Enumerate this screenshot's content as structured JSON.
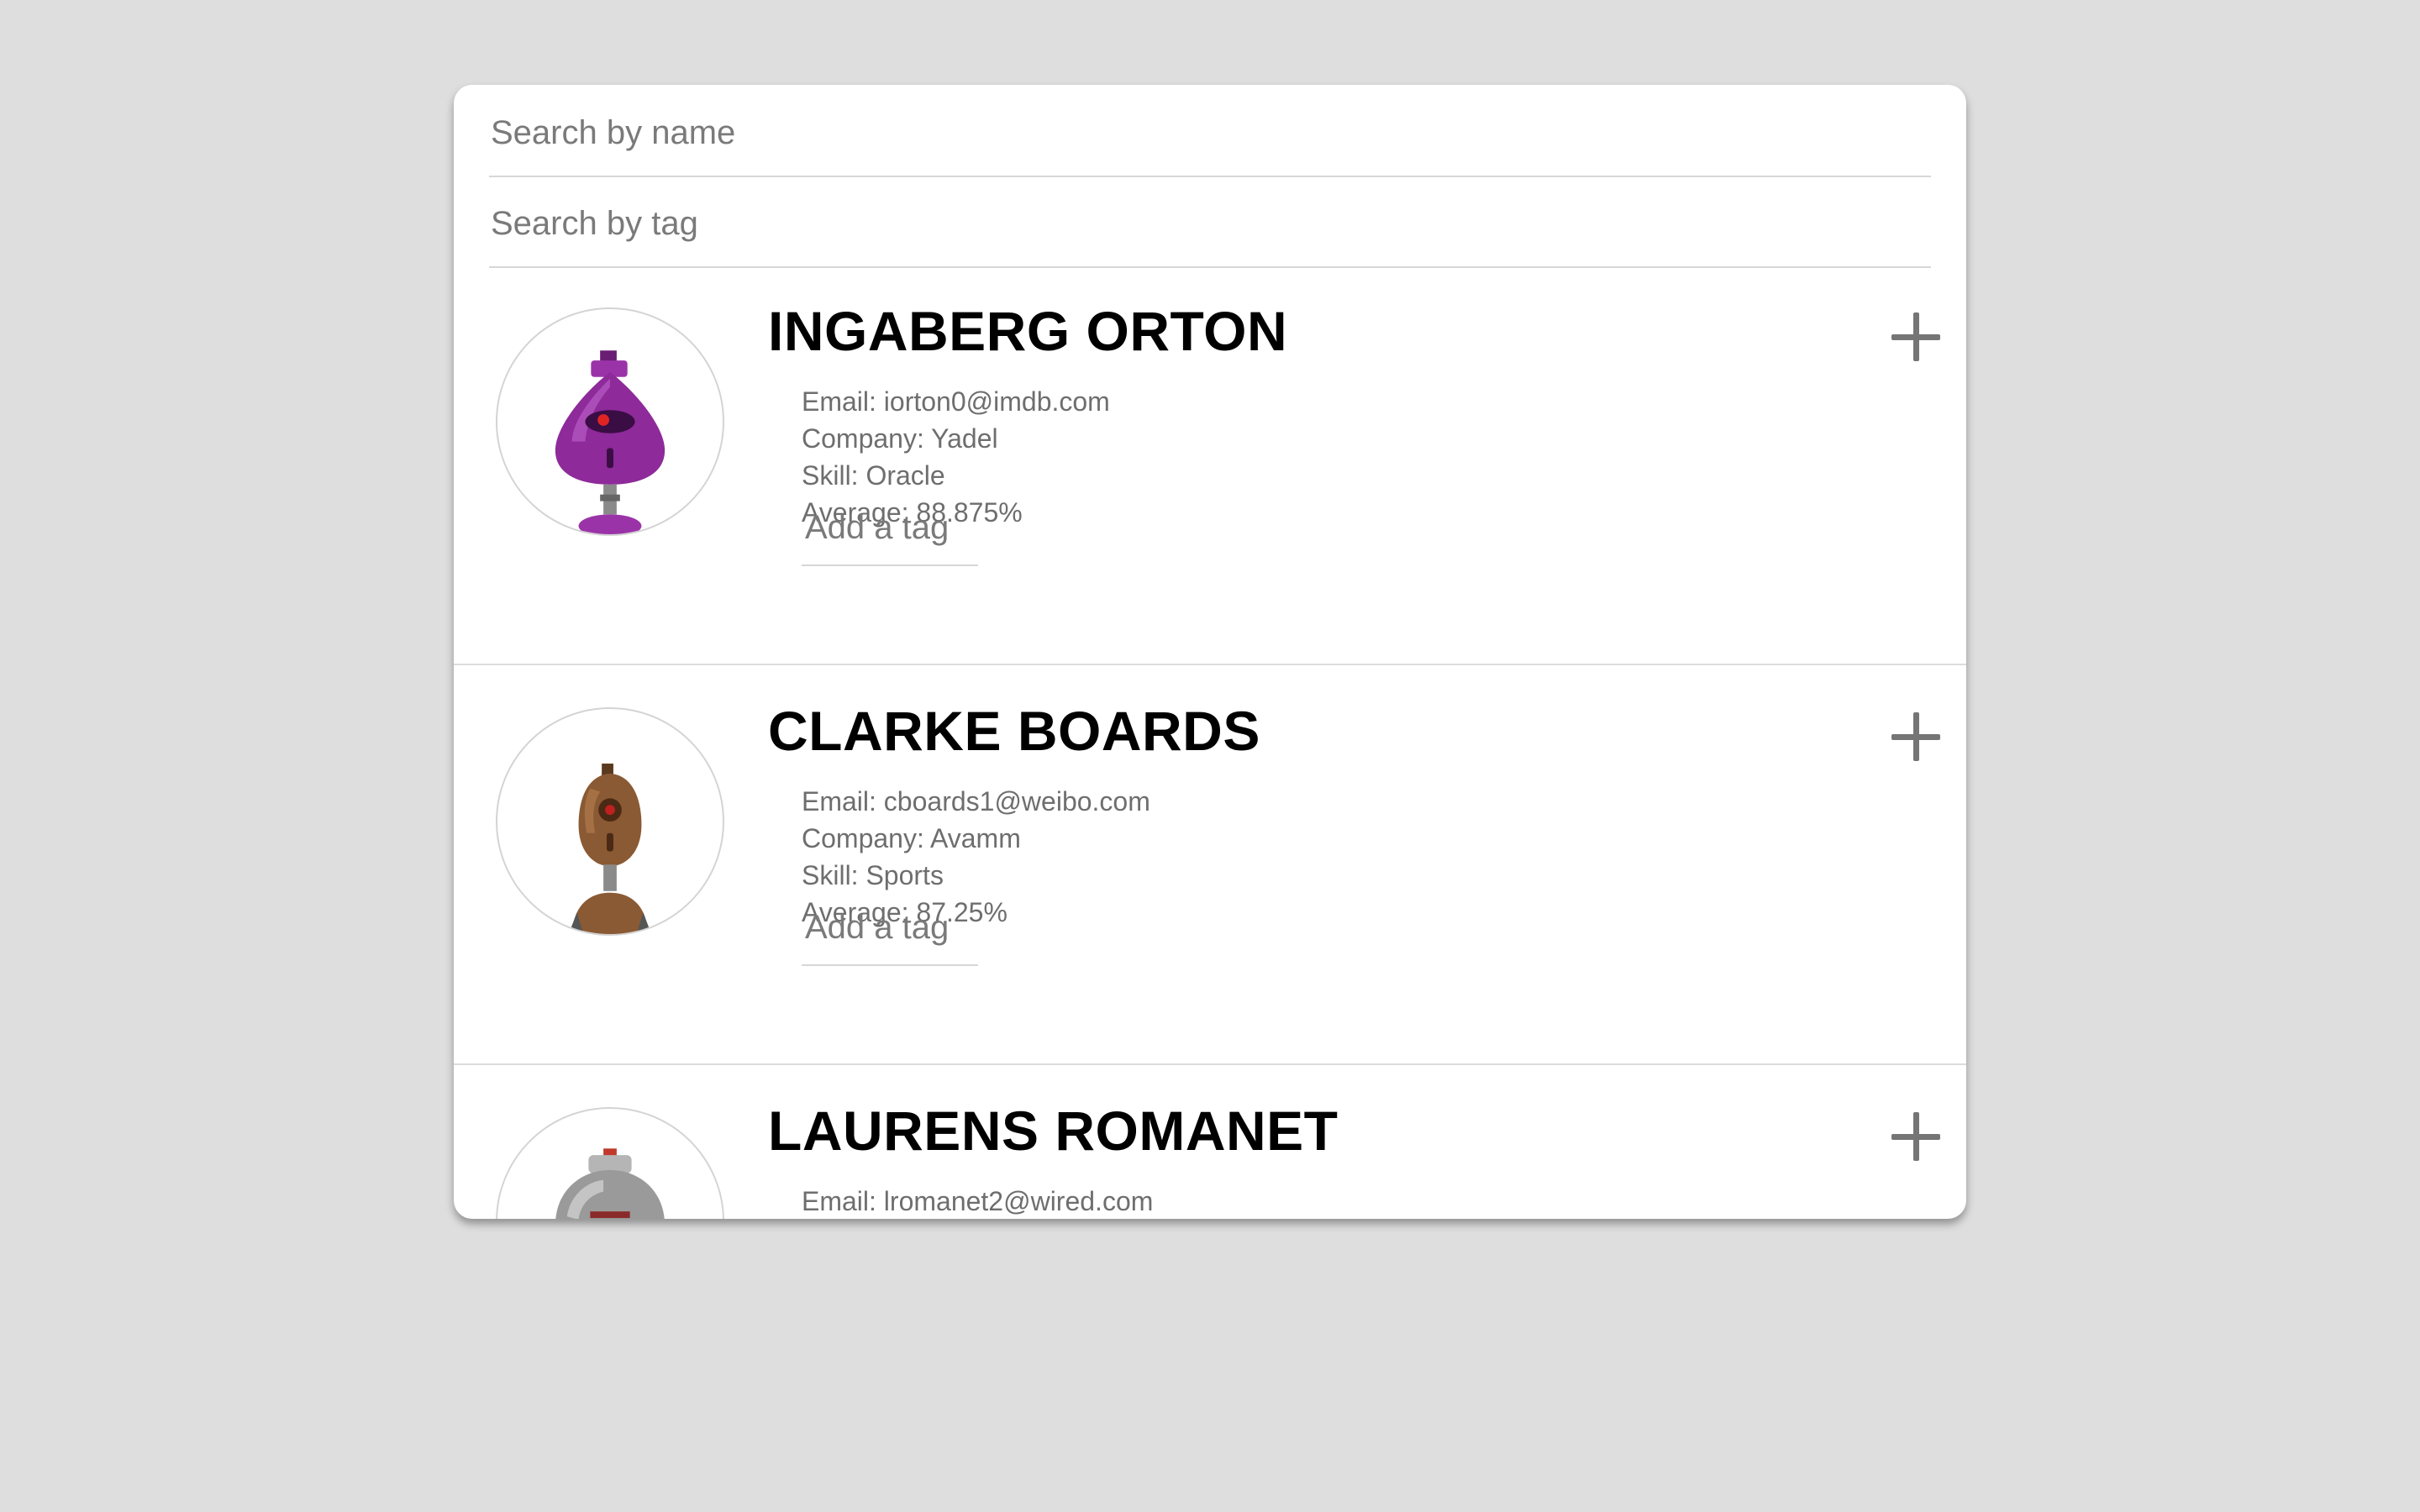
{
  "search": {
    "name_placeholder": "Search by name",
    "tag_placeholder": "Search by tag"
  },
  "students": [
    {
      "name": "INGABERG ORTON",
      "email": "Email: iorton0@imdb.com",
      "company": "Company: Yadel",
      "skill": "Skill: Oracle",
      "average": "Average: 88.875%",
      "tag_placeholder": "Add a tag",
      "avatar_icon": "purple-robot-avatar",
      "avatar_color": "#8e2a9a"
    },
    {
      "name": "CLARKE BOARDS",
      "email": "Email: cboards1@weibo.com",
      "company": "Company: Avamm",
      "skill": "Skill: Sports",
      "average": "Average: 87.25%",
      "tag_placeholder": "Add a tag",
      "avatar_icon": "brown-robot-avatar",
      "avatar_color": "#8a5a34"
    },
    {
      "name": "LAURENS ROMANET",
      "email": "Email: lromanet2@wired.com",
      "avatar_icon": "gray-robot-avatar",
      "avatar_color": "#9a9a9a"
    }
  ],
  "colors": {
    "background": "#dedede",
    "card": "#ffffff",
    "name_text": "#000000",
    "detail_text": "#6e6e6e",
    "plus_icon": "#757575"
  }
}
